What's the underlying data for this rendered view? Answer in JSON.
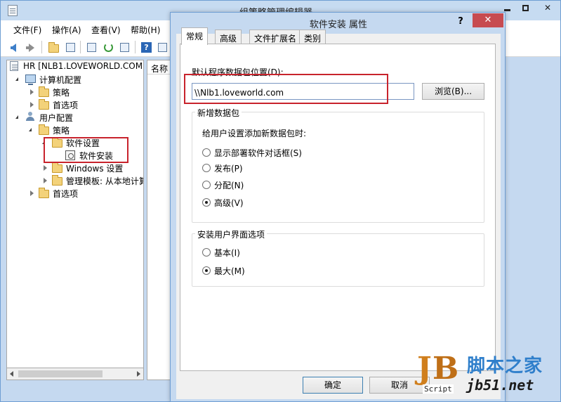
{
  "window": {
    "title": "组策略管理编辑器",
    "controls": {
      "minimize": "",
      "maximize": "",
      "close": "✕"
    }
  },
  "menu": [
    "文件(F)",
    "操作(A)",
    "查看(V)",
    "帮助(H)"
  ],
  "toolbar": {
    "icons": [
      "back-arrow-icon",
      "forward-arrow-icon",
      "up-folder-icon",
      "show-hide-tree-icon",
      "properties-icon",
      "refresh-icon",
      "export-list-icon",
      "help-icon",
      "console-icon"
    ],
    "help_glyph": "?"
  },
  "tree": {
    "root": "HR [NLB1.LOVEWORLD.COM",
    "computer_config": "计算机配置",
    "policy": "策略",
    "preferences": "首选项",
    "user_config": "用户配置",
    "user_policy": "策略",
    "software_settings": "软件设置",
    "software_install": "软件安装",
    "windows_settings": "Windows 设置",
    "admin_templates": "管理模板: 从本地计算",
    "user_preferences": "首选项"
  },
  "right_pane": {
    "column_name": "名称"
  },
  "dialog": {
    "title": "软件安装 属性",
    "help": "?",
    "close": "✕",
    "tabs": [
      "常规",
      "高级",
      "文件扩展名",
      "类别"
    ],
    "active_tab": "常规",
    "default_location_label": "默认程序数据包位置(D):",
    "default_location_value": "\\\\Nlb1.loveworld.com",
    "browse_button": "浏览(B)...",
    "new_packages_group": "新增数据包",
    "new_packages_prompt": "给用户设置添加新数据包时:",
    "new_package_options": [
      {
        "label": "显示部署软件对话框(S)",
        "checked": false
      },
      {
        "label": "发布(P)",
        "checked": false
      },
      {
        "label": "分配(N)",
        "checked": false
      },
      {
        "label": "高级(V)",
        "checked": true
      }
    ],
    "ui_group": "安装用户界面选项",
    "ui_options": [
      {
        "label": "基本(I)",
        "checked": false
      },
      {
        "label": "最大(M)",
        "checked": true
      }
    ],
    "ok_button": "确定",
    "cancel_button": "取消"
  },
  "watermark": {
    "logo_j": "J",
    "logo_b": "B",
    "logo_script": "Script",
    "site_cn": "脚本之家",
    "site_url": "jb51.net"
  },
  "colors": {
    "highlight_box": "#c8232c",
    "window_frame": "#c5d9f0",
    "close_button": "#c74b50",
    "watermark_blue": "#2f7fcb"
  }
}
